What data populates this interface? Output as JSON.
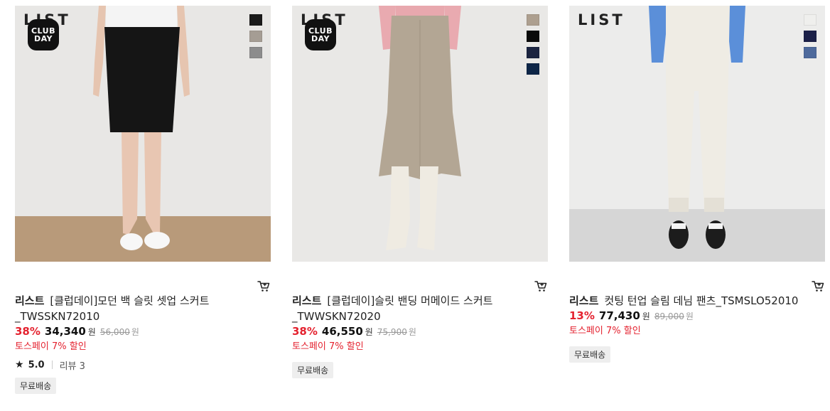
{
  "products": [
    {
      "brand_mark": "LIST",
      "club_badge": [
        "CLUB",
        "DAY"
      ],
      "swatches": [
        "#1a1a1a",
        "#a59d94",
        "#8c8c8c"
      ],
      "brand": "리스트",
      "name_line1": "[클럽데이]모던 백 슬릿 셋업 스커트",
      "name_line2": "_TWSSKN72010",
      "discount": "38%",
      "price": "34,340",
      "currency": "원",
      "original_price": "56,000",
      "original_currency": "원",
      "promo": "토스페이 7% 할인",
      "rating": "5.0",
      "review_label": "리뷰 3",
      "shipping": "무료배송"
    },
    {
      "brand_mark": "LIST",
      "club_badge": [
        "CLUB",
        "DAY"
      ],
      "swatches": [
        "#ad9f8f",
        "#0a0a0a",
        "#1b2440",
        "#0d2547"
      ],
      "brand": "리스트",
      "name_line1": "[클럽데이]슬릿 밴딩 머메이드 스커트",
      "name_line2": "_TWWSKN72020",
      "discount": "38%",
      "price": "46,550",
      "currency": "원",
      "original_price": "75,900",
      "original_currency": "원",
      "promo": "토스페이 7% 할인",
      "shipping": "무료배송"
    },
    {
      "brand_mark": "LIST",
      "swatches": [
        "#efefed",
        "#1b2048",
        "#4e6a9c"
      ],
      "brand": "리스트",
      "name_line1": "컷팅 턴업 슬림 데님 팬츠_TSMSLO52010",
      "discount": "13%",
      "price": "77,430",
      "currency": "원",
      "original_price": "89,000",
      "original_currency": "원",
      "promo": "토스페이 7% 할인",
      "shipping": "무료배송"
    }
  ],
  "icons": {
    "cart": "cart-icon",
    "star": "star-icon"
  },
  "colors": {
    "discount_red": "#e4222f",
    "badge_bg": "#eeeeee"
  }
}
